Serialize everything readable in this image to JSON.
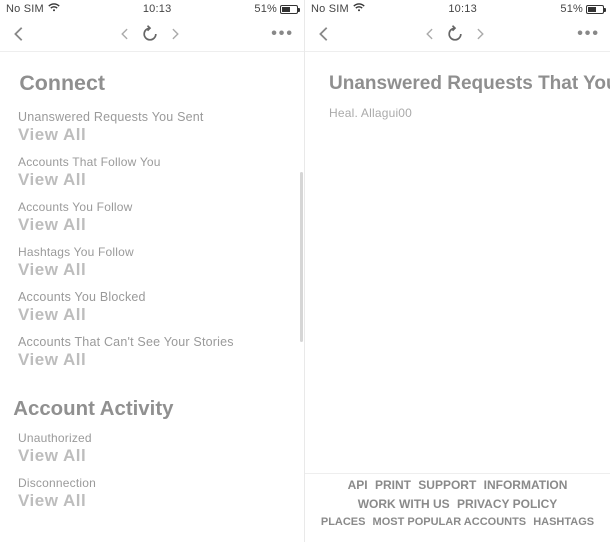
{
  "status": {
    "carrier": "No SIM",
    "time": "10:13",
    "battery": "51%"
  },
  "left": {
    "title": "Connect",
    "viewAll": "View All",
    "items": [
      "Unanswered Requests You Sent",
      "Accounts That Follow You",
      "Accounts You Follow",
      "Hashtags You Follow",
      "Accounts You Blocked",
      "Accounts That Can't See Your Stories"
    ],
    "activityHeader": "Account Activity",
    "activityItems": [
      "Unauthorized",
      "Disconnection"
    ]
  },
  "right": {
    "title": "Unanswered Requests That You Sent",
    "username": "Heal. Allagui00",
    "footer": {
      "line1": [
        "API",
        "PRINT",
        "SUPPORT",
        "INFORMATION"
      ],
      "line2": [
        "WORK WITH US",
        "PRIVACY POLICY"
      ],
      "line3": [
        "PLACES",
        "MOST POPULAR ACCOUNTS",
        "HASHTAGS"
      ]
    }
  }
}
